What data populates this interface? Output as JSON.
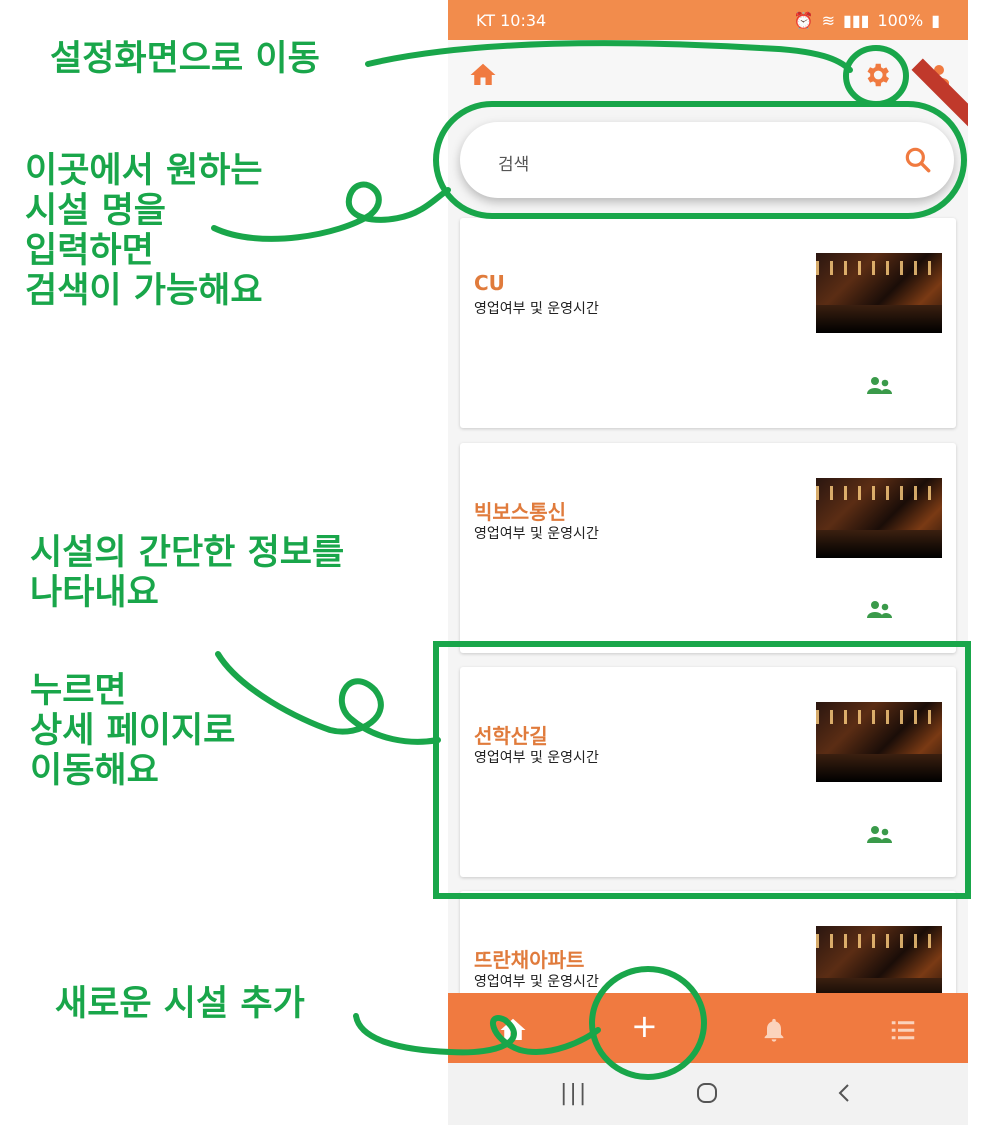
{
  "status": {
    "carrier_time": "KT 10:34",
    "battery": "100%"
  },
  "appbar": {
    "home_icon": "home-icon",
    "settings_icon": "gear-icon",
    "profile_icon": "person-icon"
  },
  "search": {
    "placeholder": "검색",
    "icon": "search-icon"
  },
  "cards": [
    {
      "title": "CU",
      "subtitle": "영업여부 및 운영시간"
    },
    {
      "title": "빅보스통신",
      "subtitle": "영업여부 및 운영시간"
    },
    {
      "title": "선학산길",
      "subtitle": "영업여부 및 운영시간"
    },
    {
      "title": "뜨란채아파트",
      "subtitle": "영업여부 및 운영시간"
    }
  ],
  "bottom_nav": {
    "add_label": "+"
  },
  "annotations": {
    "settings": "설정화면으로 이동",
    "search": "이곳에서 원하는\n시설 명을\n입력하면\n검색이 가능해요",
    "card_info": "시설의 간단한 정보를\n나타내요",
    "card_press": "누르면\n상세 페이지로\n이동해요",
    "add": "새로운 시설 추가"
  },
  "colors": {
    "accent": "#f28c4c",
    "title": "#e07b3c",
    "annotation": "#19a64a",
    "people_icon": "#3a9a4a"
  }
}
